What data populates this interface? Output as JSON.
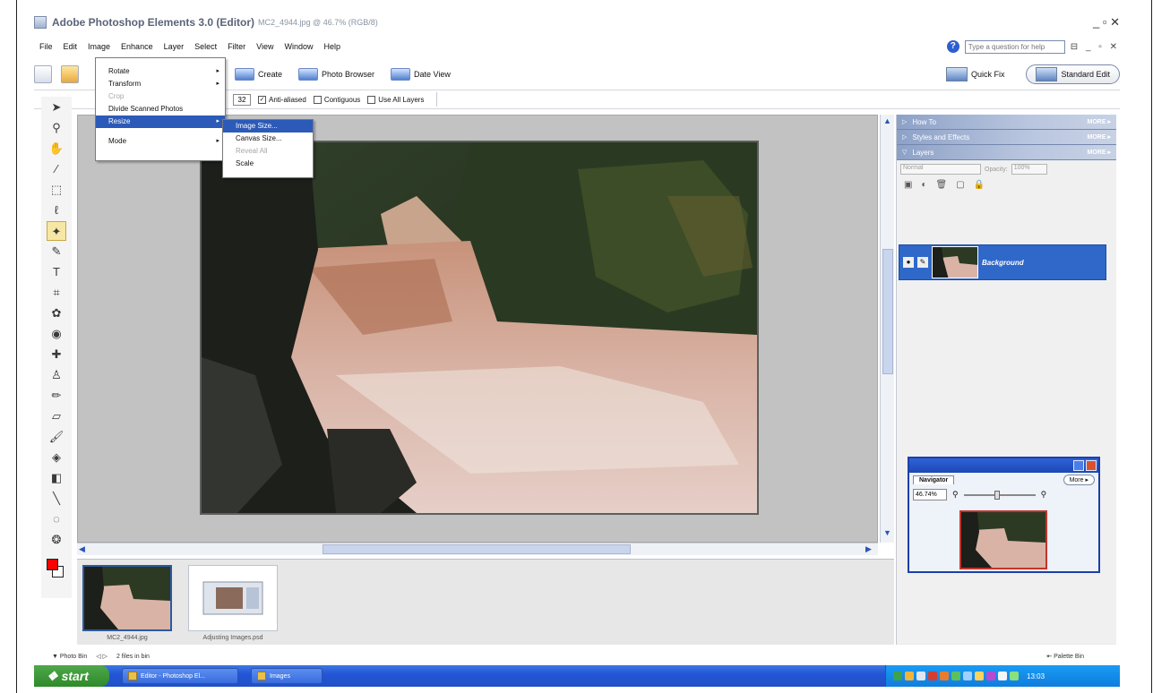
{
  "window": {
    "title": "Adobe Photoshop Elements 3.0 (Editor)",
    "file_info": "MC2_4944.jpg @ 46.7% (RGB/8)",
    "controls": "_ ▫ ✕"
  },
  "menubar": {
    "items": [
      "File",
      "Edit",
      "Image",
      "Enhance",
      "Layer",
      "Select",
      "Filter",
      "View",
      "Window",
      "Help"
    ],
    "help_placeholder": "Type a question for help",
    "mdi_controls": "⊟ _ ▫ ✕"
  },
  "shortcuts": {
    "create_label": "Create",
    "photo_browser_label": "Photo Browser",
    "date_view_label": "Date View",
    "quick_fix_label": "Quick Fix",
    "standard_edit_label": "Standard Edit"
  },
  "options_bar": {
    "tolerance_value": "32",
    "anti_aliased_label": "Anti-aliased",
    "contiguous_label": "Contiguous",
    "use_all_layers_label": "Use All Layers"
  },
  "image_menu": {
    "rotate": "Rotate",
    "transform": "Transform",
    "crop": "Crop",
    "divide": "Divide Scanned Photos",
    "resize": "Resize",
    "mode": "Mode"
  },
  "resize_submenu": {
    "image_size": "Image Size...",
    "canvas_size": "Canvas Size...",
    "reveal_all": "Reveal All",
    "scale": "Scale"
  },
  "palette": {
    "how_to": "How To",
    "styles": "Styles and Effects",
    "layers": "Layers",
    "more": "MORE",
    "blend_mode": "Normal",
    "opacity_label": "Opacity:",
    "opacity_value": "100%",
    "layer_name": "Background"
  },
  "navigator": {
    "tab_label": "Navigator",
    "more_label": "More ▸",
    "zoom_value": "46.74%"
  },
  "photo_bin": {
    "thumbs": [
      "MC2_4944.jpg",
      "Adjusting Images.psd"
    ]
  },
  "status": {
    "photo_bin_label": "Photo Bin",
    "files_info": "2 files in bin",
    "palette_bin_label": "Palette Bin"
  },
  "taskbar": {
    "start": "start",
    "task1": "Editor - Photoshop El...",
    "task2": "Images",
    "clock": "13:03"
  },
  "colors": {
    "foreground": "#ff0000",
    "background": "#ffffff",
    "selection": "#2c5ab8"
  }
}
